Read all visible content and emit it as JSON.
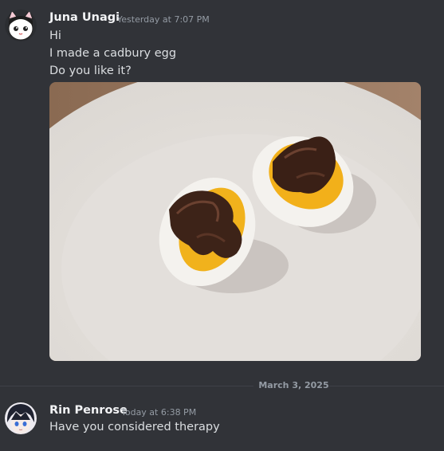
{
  "messages": [
    {
      "author": "Juna Unagi",
      "timestamp": "Yesterday at 7:07 PM",
      "lines": [
        "Hi",
        "I made a cadbury egg",
        "Do you like it?"
      ]
    },
    {
      "author": "Rin Penrose",
      "timestamp": "Today at 6:38 PM",
      "lines": [
        "Have you considered therapy"
      ]
    }
  ],
  "date_divider": "March 3, 2025",
  "colors": {
    "background": "#313338",
    "author_text": "#f2f3f5",
    "message_text": "#dbdee1",
    "muted_text": "#949ba4"
  }
}
